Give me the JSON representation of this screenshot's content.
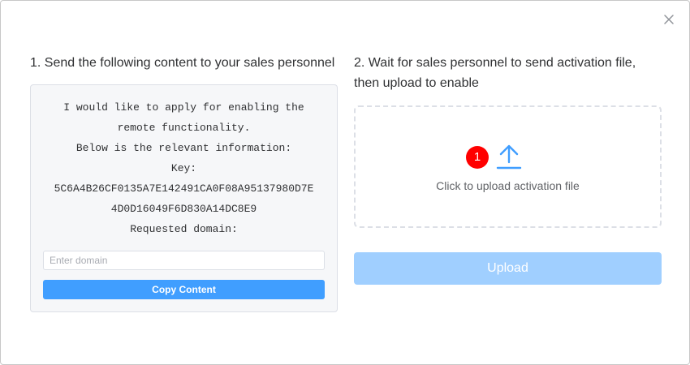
{
  "dialog": {
    "close_icon": "close-icon"
  },
  "left": {
    "title": "1. Send the following content to your sales personnel",
    "info_lines": [
      "I would like to apply for enabling the",
      "remote functionality.",
      "Below is the relevant information:",
      "Key:",
      "5C6A4B26CF0135A7E142491CA0F08A95137980D7E",
      "4D0D16049F6D830A14DC8E9",
      "Requested domain:"
    ],
    "domain_input": {
      "value": "",
      "placeholder": "Enter domain"
    },
    "copy_label": "Copy Content"
  },
  "right": {
    "title_line1": "2. Wait for sales personnel to send activation file,",
    "title_line2": "then upload to enable",
    "upload_icon": "upload-icon",
    "badge": "1",
    "upload_hint": "Click to upload activation file",
    "upload_label": "Upload"
  },
  "colors": {
    "primary": "#409eff",
    "primary_disabled": "#a0cfff",
    "badge": "#ff0000",
    "upload_icon": "#409eff"
  }
}
